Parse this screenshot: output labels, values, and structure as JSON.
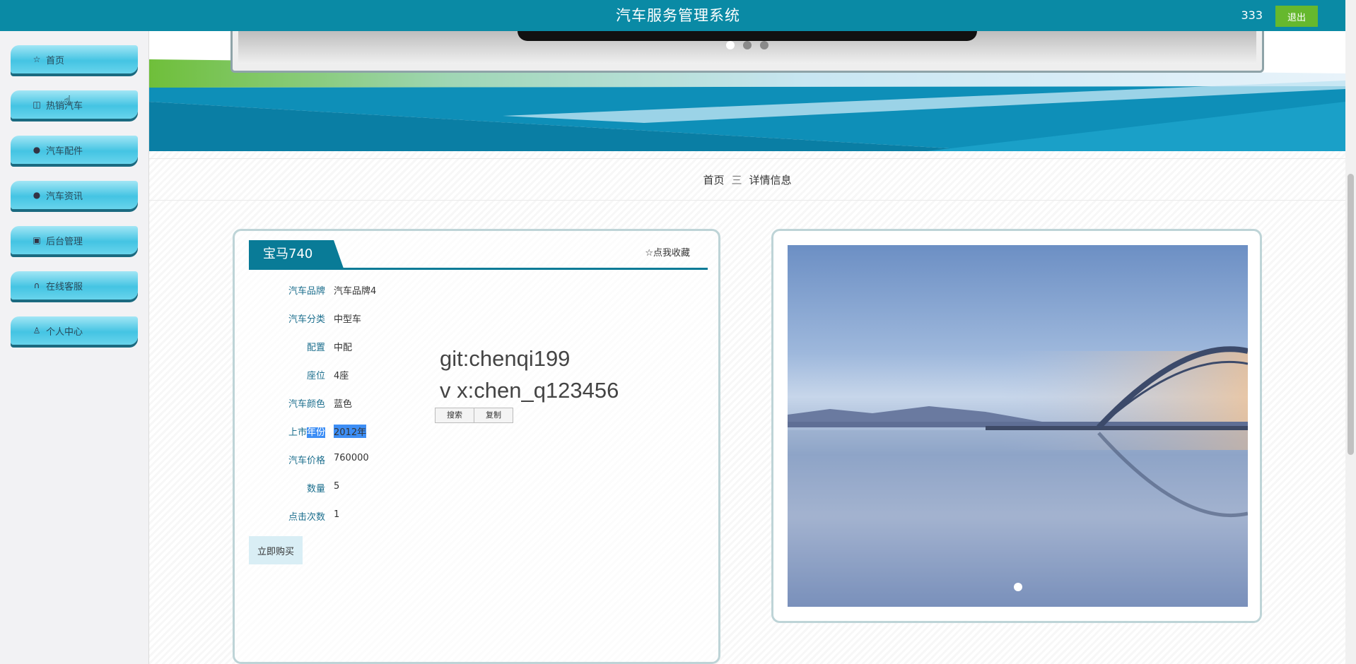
{
  "header": {
    "title": "汽车服务管理系统",
    "user": "333",
    "logout_label": "退出"
  },
  "sidebar": {
    "items": [
      {
        "label": "首页",
        "icon": "star-icon"
      },
      {
        "label": "热销汽车",
        "icon": "bag-icon"
      },
      {
        "label": "汽车配件",
        "icon": "info-icon"
      },
      {
        "label": "汽车资讯",
        "icon": "question-icon"
      },
      {
        "label": "后台管理",
        "icon": "store-icon"
      },
      {
        "label": "在线客服",
        "icon": "headset-icon"
      },
      {
        "label": "个人中心",
        "icon": "user-icon"
      }
    ]
  },
  "breadcrumb": {
    "home": "首页",
    "separator": "三",
    "current": "详情信息"
  },
  "detail": {
    "title": "宝马740",
    "favorite_label": "☆点我收藏",
    "fields": [
      {
        "label": "汽车品牌",
        "value": "汽车品牌4"
      },
      {
        "label": "汽车分类",
        "value": "中型车"
      },
      {
        "label": "配置",
        "value": "中配"
      },
      {
        "label": "座位",
        "value": "4座"
      },
      {
        "label": "汽车颜色",
        "value": "蓝色"
      },
      {
        "label_plain": "上市",
        "label_selected": "年份",
        "value": "2012年"
      },
      {
        "label": "汽车价格",
        "value": "760000"
      },
      {
        "label": "数量",
        "value": "5"
      },
      {
        "label": "点击次数",
        "value": "1"
      }
    ],
    "buy_label": "立即购买"
  },
  "overlay": {
    "line1": "git:chenqi199",
    "line2": "v x:chen_q123456",
    "search_label": "搜索",
    "copy_label": "复制"
  },
  "colors": {
    "header": "#0a8aa5",
    "accent": "#097b97",
    "logout": "#66b82e",
    "selection": "#3d8ef5"
  }
}
